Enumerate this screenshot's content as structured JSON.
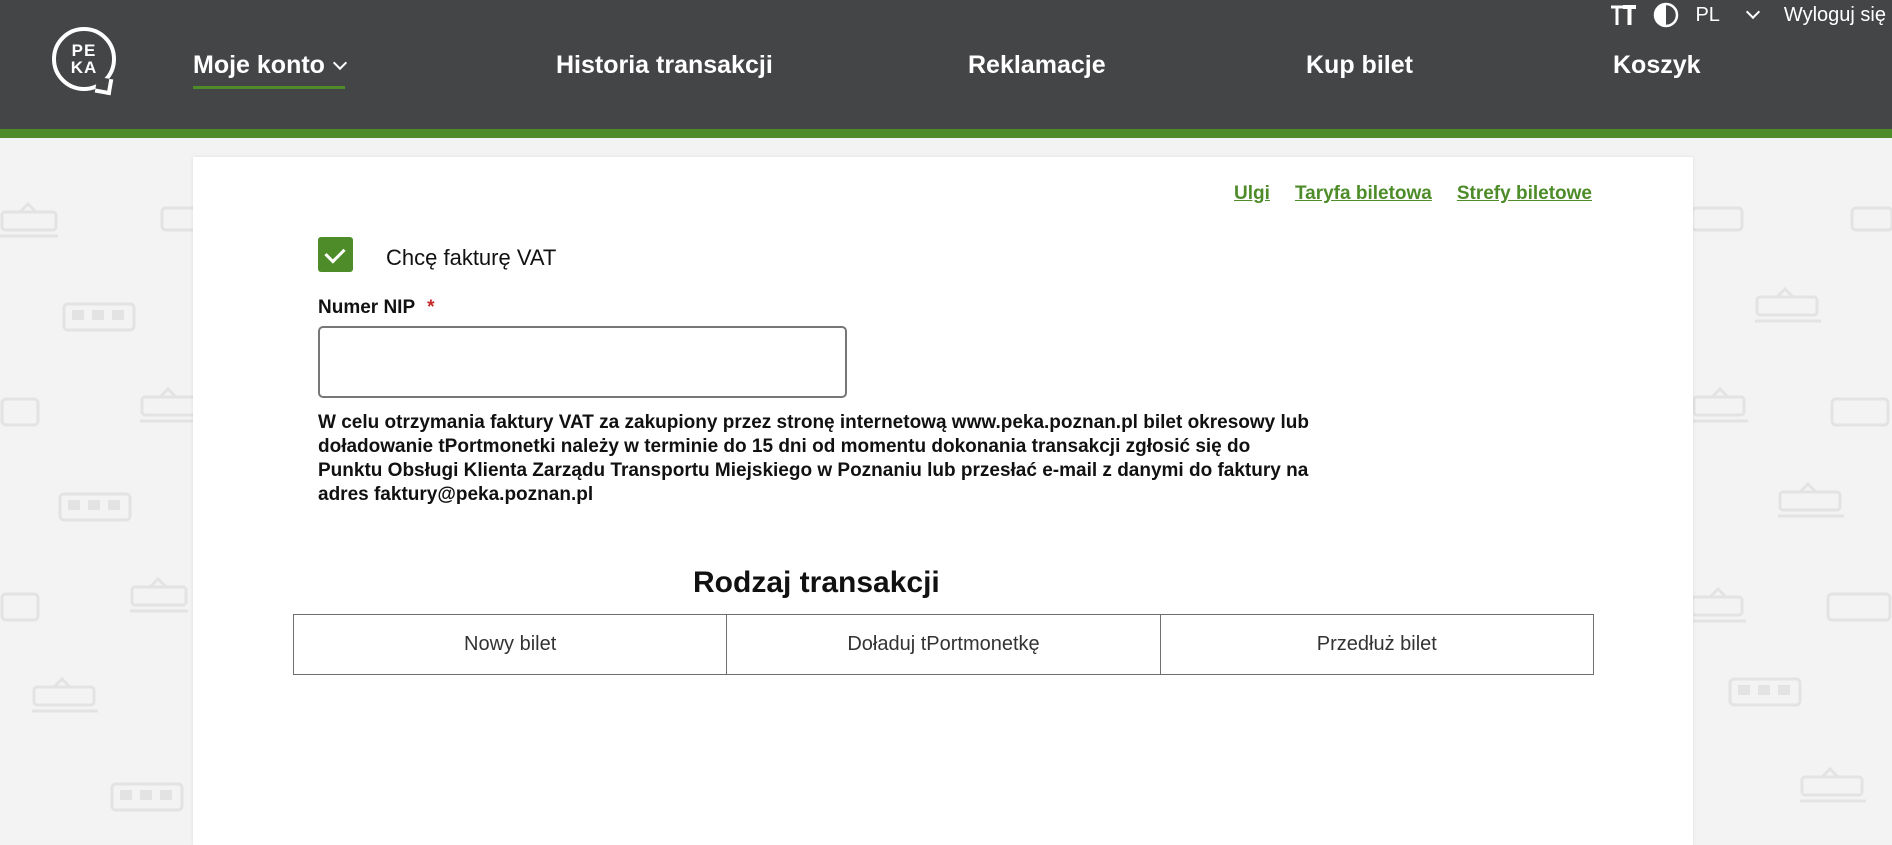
{
  "header": {
    "logo_text": "PE KA",
    "nav": [
      {
        "label": "Moje konto"
      },
      {
        "label": "Historia transakcji"
      },
      {
        "label": "Reklamacje"
      },
      {
        "label": "Kup bilet"
      },
      {
        "label": "Koszyk"
      }
    ],
    "topbar": {
      "font_size_icon": "text-size-icon",
      "contrast_icon": "contrast-icon",
      "language": "PL",
      "logout": "Wyloguj się"
    }
  },
  "links": [
    "Ulgi",
    "Taryfa biletowa",
    "Strefy biletowe"
  ],
  "invoice": {
    "checkbox_label": "Chcę fakturę VAT",
    "checked": true,
    "nip_label": "Numer NIP",
    "required_mark": "*",
    "nip_value": "",
    "info": "W celu otrzymania faktury VAT za zakupiony przez stronę internetową www.peka.poznan.pl bilet okresowy lub doładowanie tPortmonetki należy w terminie do 15 dni od momentu dokonania transakcji zgłosić się do Punktu Obsługi Klienta Zarządu Transportu Miejskiego w Poznaniu lub przesłać e-mail z danymi do faktury na adres faktury@peka.poznan.pl"
  },
  "transaction": {
    "title": "Rodzaj transakcji",
    "options": [
      "Nowy bilet",
      "Doładuj tPortmonetkę",
      "Przedłuż bilet"
    ]
  },
  "colors": {
    "header_bg": "#444547",
    "accent_green": "#4e8c2a",
    "required_red": "#c62828"
  }
}
